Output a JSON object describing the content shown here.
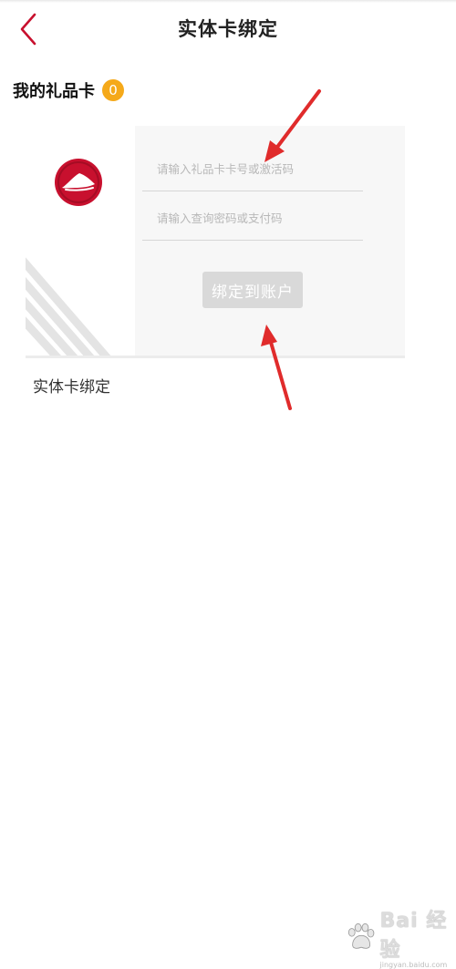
{
  "header": {
    "title": "实体卡绑定",
    "back_icon": "chevron-left-icon"
  },
  "gift_cards": {
    "title": "我的礼品卡",
    "count": "0",
    "badge_color": "#f5a91a"
  },
  "bind_card": {
    "logo_icon": "pizza-hut-logo-icon",
    "card_number_placeholder": "请输入礼品卡卡号或激活码",
    "password_placeholder": "请输入查询密码或支付码",
    "bind_button_label": "绑定到账户",
    "caption": "实体卡绑定"
  },
  "watermark": {
    "brand": "Bai 经验",
    "url": "jingyan.baidu.com"
  },
  "colors": {
    "accent": "#c8102e",
    "annotation": "#e02b2b",
    "button_disabled": "#d9d9d9"
  }
}
